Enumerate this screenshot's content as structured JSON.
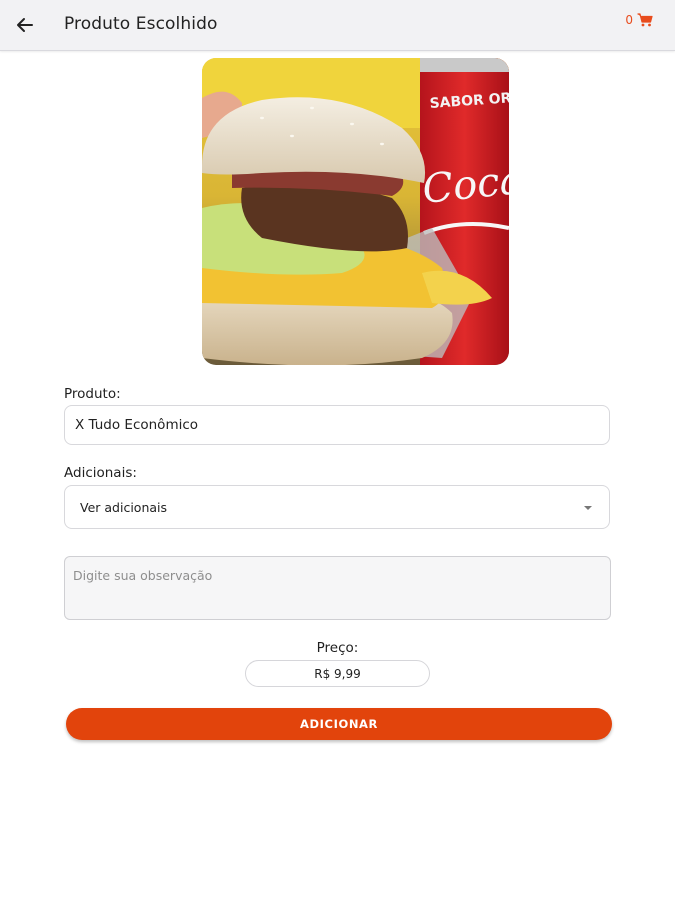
{
  "header": {
    "title": "Produto Escolhido",
    "cart_count": "0",
    "back_icon": "arrow-left-icon",
    "cart_icon": "shopping-cart-icon",
    "accent_color": "#e84c1d"
  },
  "product": {
    "image_alt": "X Tudo Econômico",
    "label": "Produto:",
    "name": "X Tudo Econômico"
  },
  "extras": {
    "label": "Adicionais:",
    "selected": "Ver adicionais"
  },
  "observation": {
    "placeholder": "Digite sua observação",
    "value": ""
  },
  "price": {
    "label": "Preço:",
    "value": "R$ 9,99"
  },
  "actions": {
    "add_label": "ADICIONAR",
    "button_color": "#e2440c"
  }
}
